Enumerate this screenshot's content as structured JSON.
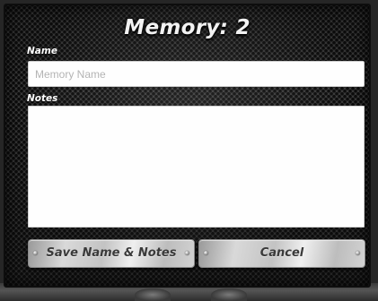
{
  "dialog": {
    "title": "Memory: 2",
    "name_label": "Name",
    "name_value": "",
    "name_placeholder": "Memory Name",
    "notes_label": "Notes",
    "notes_value": ""
  },
  "buttons": {
    "save_label": "Save Name & Notes",
    "cancel_label": "Cancel"
  },
  "icons": {
    "button_rivet": "rivet-icon"
  }
}
